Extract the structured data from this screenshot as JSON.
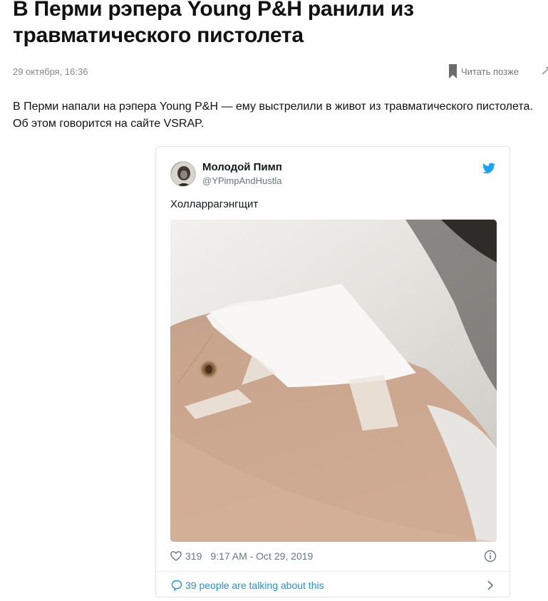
{
  "article": {
    "headline": "В Перми рэпера Young P&H ранили из травматического пистолета",
    "date": "29 октября, 16:36",
    "read_later_label": "Читать позже",
    "lead": "В Перми напали на рэпера Young P&H — ему выстрелили в живот из травматического пистолета. Об этом говорится на сайте VSRAP."
  },
  "tweet": {
    "author_name": "Молодой Пимп",
    "author_handle": "@YPimpAndHustla",
    "text": "Холларрагэнгщит",
    "likes": "319",
    "timestamp": "9:17 AM - Oct 29, 2019",
    "talking_label": "39 people are talking about this",
    "brand_color": "#1da1f2",
    "link_color": "#1b95e0"
  },
  "icons": {
    "bookmark": "bookmark-icon",
    "share": "share-icon",
    "twitter": "twitter-icon",
    "heart": "heart-icon",
    "info": "info-icon",
    "talk": "speech-bubble-icon",
    "chevron": "chevron-right-icon"
  }
}
